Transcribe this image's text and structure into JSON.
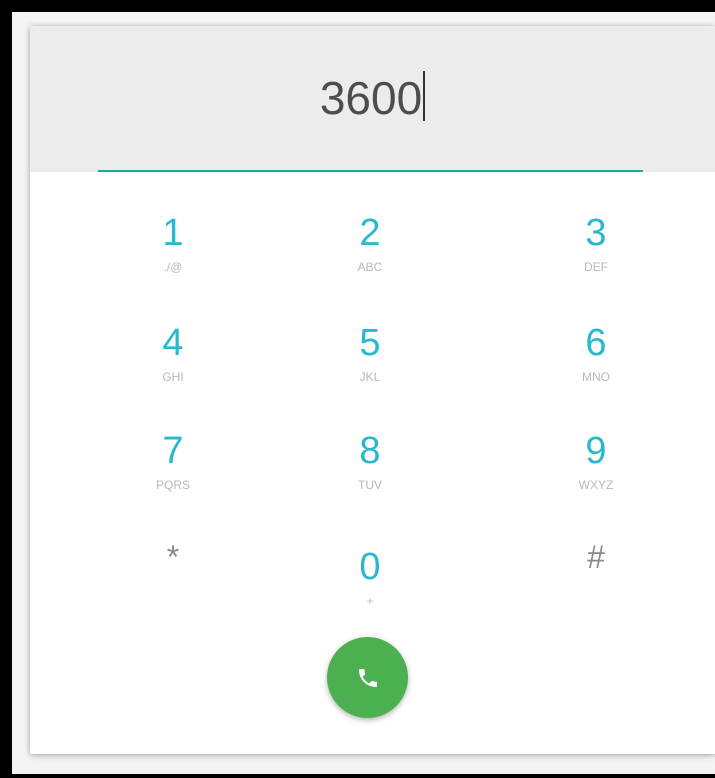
{
  "display": {
    "number": "3600"
  },
  "keypad": {
    "keys": [
      {
        "digit": "1",
        "letters": "./@"
      },
      {
        "digit": "2",
        "letters": "ABC"
      },
      {
        "digit": "3",
        "letters": "DEF"
      },
      {
        "digit": "4",
        "letters": "GHI"
      },
      {
        "digit": "5",
        "letters": "JKL"
      },
      {
        "digit": "6",
        "letters": "MNO"
      },
      {
        "digit": "7",
        "letters": "PQRS"
      },
      {
        "digit": "8",
        "letters": "TUV"
      },
      {
        "digit": "9",
        "letters": "WXYZ"
      },
      {
        "digit": "*",
        "letters": ""
      },
      {
        "digit": "0",
        "letters": "+"
      },
      {
        "digit": "#",
        "letters": ""
      }
    ]
  },
  "call_button": {
    "icon": "phone-icon",
    "color": "#4caf50"
  },
  "colors": {
    "accent": "#29b8cf",
    "underline": "#1fa6a0",
    "call": "#4caf50"
  }
}
